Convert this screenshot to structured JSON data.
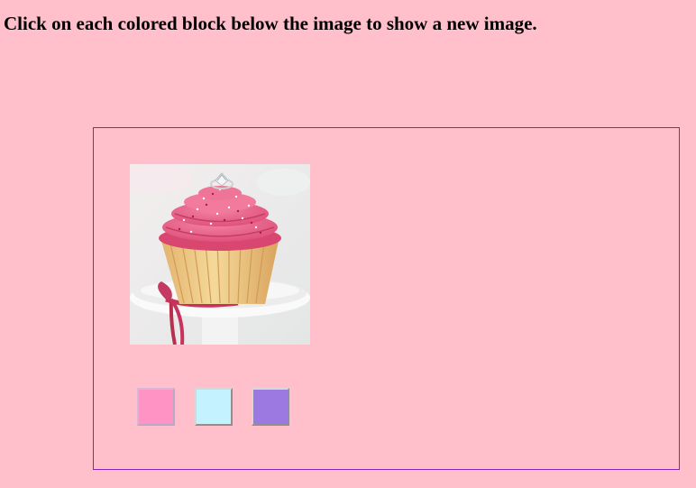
{
  "instruction": "Click on each colored block below the image to show a new image.",
  "image": {
    "alt": "Pink frosted cupcake with a diamond ring on a white cake stand"
  },
  "swatches": [
    {
      "name": "pink",
      "color": "#ff94c4"
    },
    {
      "name": "light-cyan",
      "color": "#c4f2ff"
    },
    {
      "name": "purple",
      "color": "#9c79e0"
    }
  ],
  "colors": {
    "background": "#ffbfcb",
    "frame_border": "#8a22b8"
  }
}
